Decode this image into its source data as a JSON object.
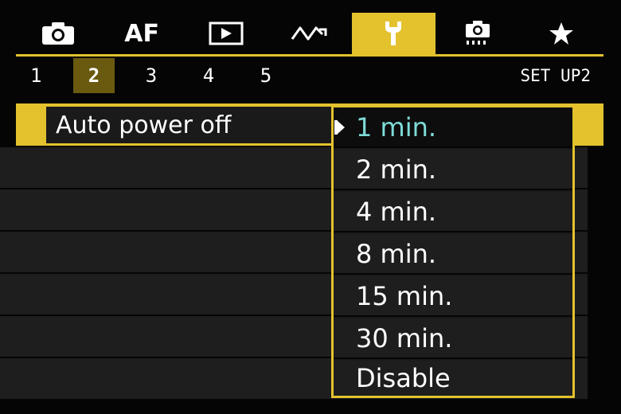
{
  "tabs": [
    {
      "name": "camera-icon",
      "label": "",
      "active": false
    },
    {
      "name": "af",
      "label": "AF",
      "active": false
    },
    {
      "name": "playback-icon",
      "label": "",
      "active": false
    },
    {
      "name": "custom-wave-icon",
      "label": "",
      "active": false
    },
    {
      "name": "wrench-icon",
      "label": "",
      "active": true
    },
    {
      "name": "custom-camera-icon",
      "label": "",
      "active": false
    },
    {
      "name": "star-icon",
      "label": "",
      "active": false
    }
  ],
  "pages": [
    "1",
    "2",
    "3",
    "4",
    "5"
  ],
  "active_page": "2",
  "menu_id": "SET UP2",
  "setting": {
    "label": "Auto power off"
  },
  "options": [
    "1 min.",
    "2 min.",
    "4 min.",
    "8 min.",
    "15 min.",
    "30 min.",
    "Disable"
  ],
  "selected_option": "1 min.",
  "colors": {
    "accent": "#e3c22e",
    "selected_text": "#7fdcd7",
    "background": "#050505",
    "row": "#1e1e1e"
  }
}
